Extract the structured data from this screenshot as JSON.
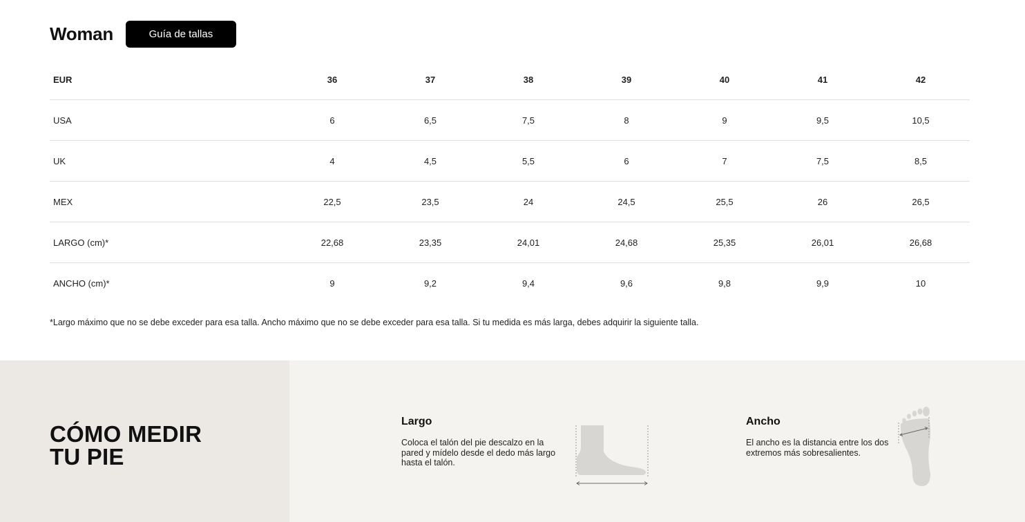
{
  "header": {
    "title": "Woman",
    "guide_button": "Guía de tallas"
  },
  "table": {
    "header": {
      "label": "EUR",
      "sizes": [
        "36",
        "37",
        "38",
        "39",
        "40",
        "41",
        "42"
      ]
    },
    "rows": [
      {
        "label": "USA",
        "values": [
          "6",
          "6,5",
          "7,5",
          "8",
          "9",
          "9,5",
          "10,5"
        ]
      },
      {
        "label": "UK",
        "values": [
          "4",
          "4,5",
          "5,5",
          "6",
          "7",
          "7,5",
          "8,5"
        ]
      },
      {
        "label": "MEX",
        "values": [
          "22,5",
          "23,5",
          "24",
          "24,5",
          "25,5",
          "26",
          "26,5"
        ]
      },
      {
        "label": "LARGO (cm)*",
        "values": [
          "22,68",
          "23,35",
          "24,01",
          "24,68",
          "25,35",
          "26,01",
          "26,68"
        ]
      },
      {
        "label": "ANCHO (cm)*",
        "values": [
          "9",
          "9,2",
          "9,4",
          "9,6",
          "9,8",
          "9,9",
          "10"
        ]
      }
    ]
  },
  "footnote": "*Largo máximo que no se debe exceder para esa talla. Ancho máximo que no se debe exceder para esa talla. Si tu medida es más larga, debes adquirir la siguiente talla.",
  "measure": {
    "title_line1": "CÓMO MEDIR",
    "title_line2": "TU PIE",
    "largo": {
      "title": "Largo",
      "text": "Coloca el talón del pie descalzo en la pared y mídelo desde el dedo más largo hasta el talón."
    },
    "ancho": {
      "title": "Ancho",
      "text": "El ancho es la distancia entre los dos extremos más sobresalientes."
    },
    "icons": [
      "foot-side-length-icon",
      "foot-sole-width-icon"
    ]
  },
  "colors": {
    "button_bg": "#000000",
    "measure_left_bg": "#ece9e5",
    "measure_right_bg": "#f5f3ef",
    "divider": "#dddddd",
    "foot_fill": "#d8d6d3"
  }
}
